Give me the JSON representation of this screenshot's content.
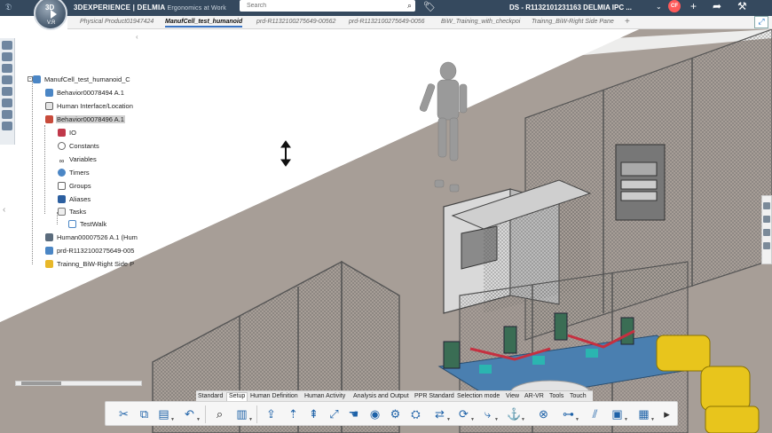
{
  "topbar": {
    "logo_icon": "3ds-logo-icon",
    "compass": {
      "label": "3D",
      "version": "V.R"
    },
    "brand": "3DEXPERIENCE | DELMIA",
    "app_name": "Ergonomics at Work",
    "search_placeholder": "Search",
    "session_title": "DS - R1132101231163 DELMIA IPC ...",
    "avatar_initials": "CF",
    "icons": [
      "tag-icon",
      "add-icon",
      "share-icon",
      "tools-icon"
    ]
  },
  "tabs": [
    {
      "label": "Physical Product01947424"
    },
    {
      "label": "ManufCell_test_humanoid",
      "active": true
    },
    {
      "label": "prd-R1132100275649-00562"
    },
    {
      "label": "prd-R1132100275649-0056"
    },
    {
      "label": "BiW_Training_with_checkpoi"
    },
    {
      "label": "Trainng_BiW-Right Side Pane"
    }
  ],
  "tree": {
    "root": "ManufCell_test_humanoid_C",
    "items": [
      {
        "label": "Behavior00078494 A.1"
      },
      {
        "label": "Human Interface/Location"
      },
      {
        "label": "Behavior00078496 A.1",
        "selected": true
      },
      {
        "label": "IO"
      },
      {
        "label": "Constants"
      },
      {
        "label": "Variables"
      },
      {
        "label": "Timers"
      },
      {
        "label": "Groups"
      },
      {
        "label": "Aliases"
      },
      {
        "label": "Tasks"
      },
      {
        "label": "TestWalk"
      },
      {
        "label": "Human00007526 A.1 (Hum"
      },
      {
        "label": "prd-R1132100275649-005"
      },
      {
        "label": "Trainng_BiW-Right Side P"
      }
    ]
  },
  "action_tabs": [
    {
      "label": "Standard"
    },
    {
      "label": "Setup",
      "active": true
    },
    {
      "label": "Human Definition"
    },
    {
      "label": "Human Activity"
    },
    {
      "label": "Analysis and Output"
    },
    {
      "label": "PPR Standard"
    },
    {
      "label": "Selection mode"
    },
    {
      "label": "View"
    },
    {
      "label": "AR-VR"
    },
    {
      "label": "Tools"
    },
    {
      "label": "Touch"
    }
  ],
  "tools": [
    {
      "icon": "cut-icon",
      "glyph": "✂"
    },
    {
      "icon": "copy-icon",
      "glyph": "⧉"
    },
    {
      "icon": "paste-icon",
      "glyph": "📋"
    },
    {
      "icon": "undo-icon",
      "glyph": "↶"
    },
    {
      "icon": "zoom-icon",
      "glyph": "🔍"
    },
    {
      "icon": "catalog-icon",
      "glyph": "📖"
    },
    {
      "icon": "insert-icon",
      "glyph": "⇪"
    },
    {
      "icon": "walk-icon",
      "glyph": "🚶"
    },
    {
      "icon": "posture-icon",
      "glyph": "⇡"
    },
    {
      "icon": "reach-icon",
      "glyph": "⤢"
    },
    {
      "icon": "hand-icon",
      "glyph": "✋"
    },
    {
      "icon": "vision-icon",
      "glyph": "◉"
    },
    {
      "icon": "analysis-icon",
      "glyph": "⚙"
    },
    {
      "icon": "gear-group-icon",
      "glyph": "⚙"
    },
    {
      "icon": "swap-icon",
      "glyph": "⇄"
    },
    {
      "icon": "robot-icon",
      "glyph": "⛭"
    },
    {
      "icon": "anchor-icon",
      "glyph": "⚓"
    },
    {
      "icon": "pose-icon",
      "glyph": "⤷"
    },
    {
      "icon": "constraint-icon",
      "glyph": "⊗"
    },
    {
      "icon": "graph-icon",
      "glyph": "📈"
    },
    {
      "icon": "box-icon",
      "glyph": "▣"
    },
    {
      "icon": "camera-icon",
      "glyph": "📷"
    }
  ]
}
